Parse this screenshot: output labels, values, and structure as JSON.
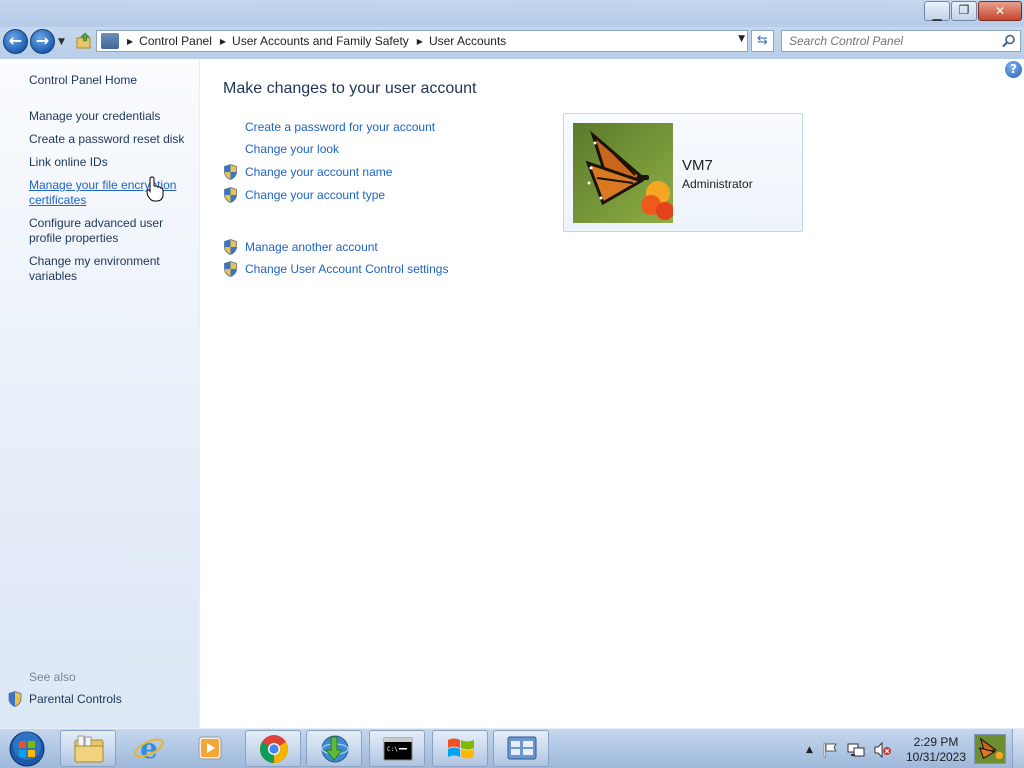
{
  "window": {
    "minimize_glyph": "▁",
    "maximize_glyph": "❐",
    "close_glyph": "✕"
  },
  "nav": {
    "back_glyph": "←",
    "forward_glyph": "→",
    "breadcrumbs": [
      "Control Panel",
      "User Accounts and Family Safety",
      "User Accounts"
    ],
    "search_placeholder": "Search Control Panel"
  },
  "left_pane": {
    "home": "Control Panel Home",
    "links": [
      {
        "line1": "Manage your credentials",
        "line2": ""
      },
      {
        "line1": "Create a password reset disk",
        "line2": ""
      },
      {
        "line1": "Link online IDs",
        "line2": ""
      },
      {
        "line1": "Manage your file encryption",
        "line2": "certificates"
      },
      {
        "line1": "Configure advanced user",
        "line2": "profile properties"
      },
      {
        "line1": "Change my environment",
        "line2": "variables"
      }
    ],
    "see_also": "See also",
    "parental_controls": "Parental Controls"
  },
  "main": {
    "title": "Make changes to your user account",
    "tasks": [
      "Create a password for your account",
      "Change your look",
      "Change your account name",
      "Change your account type"
    ],
    "other_tasks": [
      "Manage another account",
      "Change User Account Control settings"
    ],
    "account": {
      "name": "VM7",
      "role": "Administrator"
    },
    "help_glyph": "?"
  },
  "taskbar": {
    "time": "2:29 PM",
    "date": "10/31/2023",
    "apps": [
      "windows-explorer-icon",
      "internet-explorer-icon",
      "media-player-icon",
      "chrome-icon",
      "download-manager-icon",
      "command-prompt-icon",
      "windows-flag-icon",
      "control-panel-icon"
    ]
  },
  "colors": {
    "link": "#1f63c6",
    "heading": "#1e3559",
    "chrome": "#b5cbe7"
  }
}
